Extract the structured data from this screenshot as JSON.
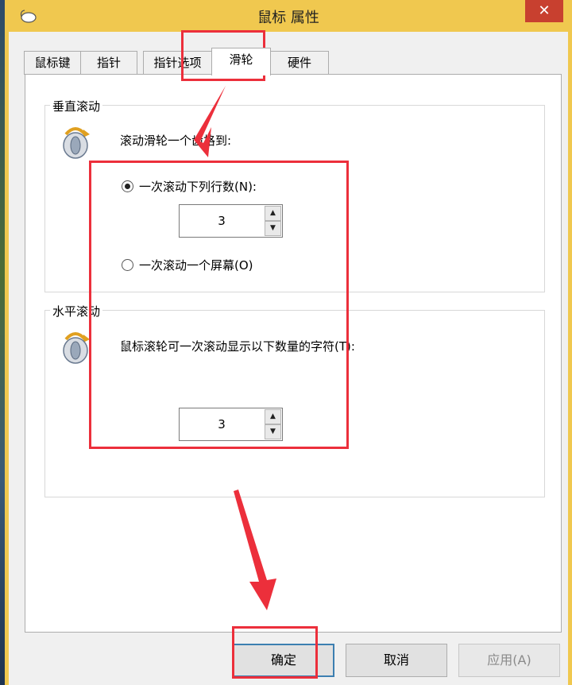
{
  "window": {
    "title": "鼠标 属性",
    "close_glyph": "✕"
  },
  "tabs": [
    {
      "label": "鼠标键"
    },
    {
      "label": "指针"
    },
    {
      "label": "指针选项"
    },
    {
      "label": "滑轮"
    },
    {
      "label": "硬件"
    }
  ],
  "active_tab": "滑轮",
  "vertical": {
    "title": "垂直滚动",
    "description": "滚动滑轮一个齿格到:",
    "option_lines": "一次滚动下列行数(N):",
    "option_screen": "一次滚动一个屏幕(O)",
    "lines_value": "3",
    "selected": "lines"
  },
  "horizontal": {
    "title": "水平滚动",
    "description": "鼠标滚轮可一次滚动显示以下数量的字符(T):",
    "chars_value": "3"
  },
  "buttons": {
    "ok": "确定",
    "cancel": "取消",
    "apply": "应用(A)"
  },
  "spin_glyphs": {
    "up": "▲",
    "down": "▼"
  },
  "colors": {
    "titlebar": "#f0c84f",
    "close": "#c8402f",
    "annotation": "#ec2f3b",
    "default_border": "#3c7fb1"
  },
  "icons": [
    "mouse-icon",
    "mouse-wheel-icon",
    "close-icon",
    "arrow-up-icon",
    "arrow-down-icon"
  ]
}
